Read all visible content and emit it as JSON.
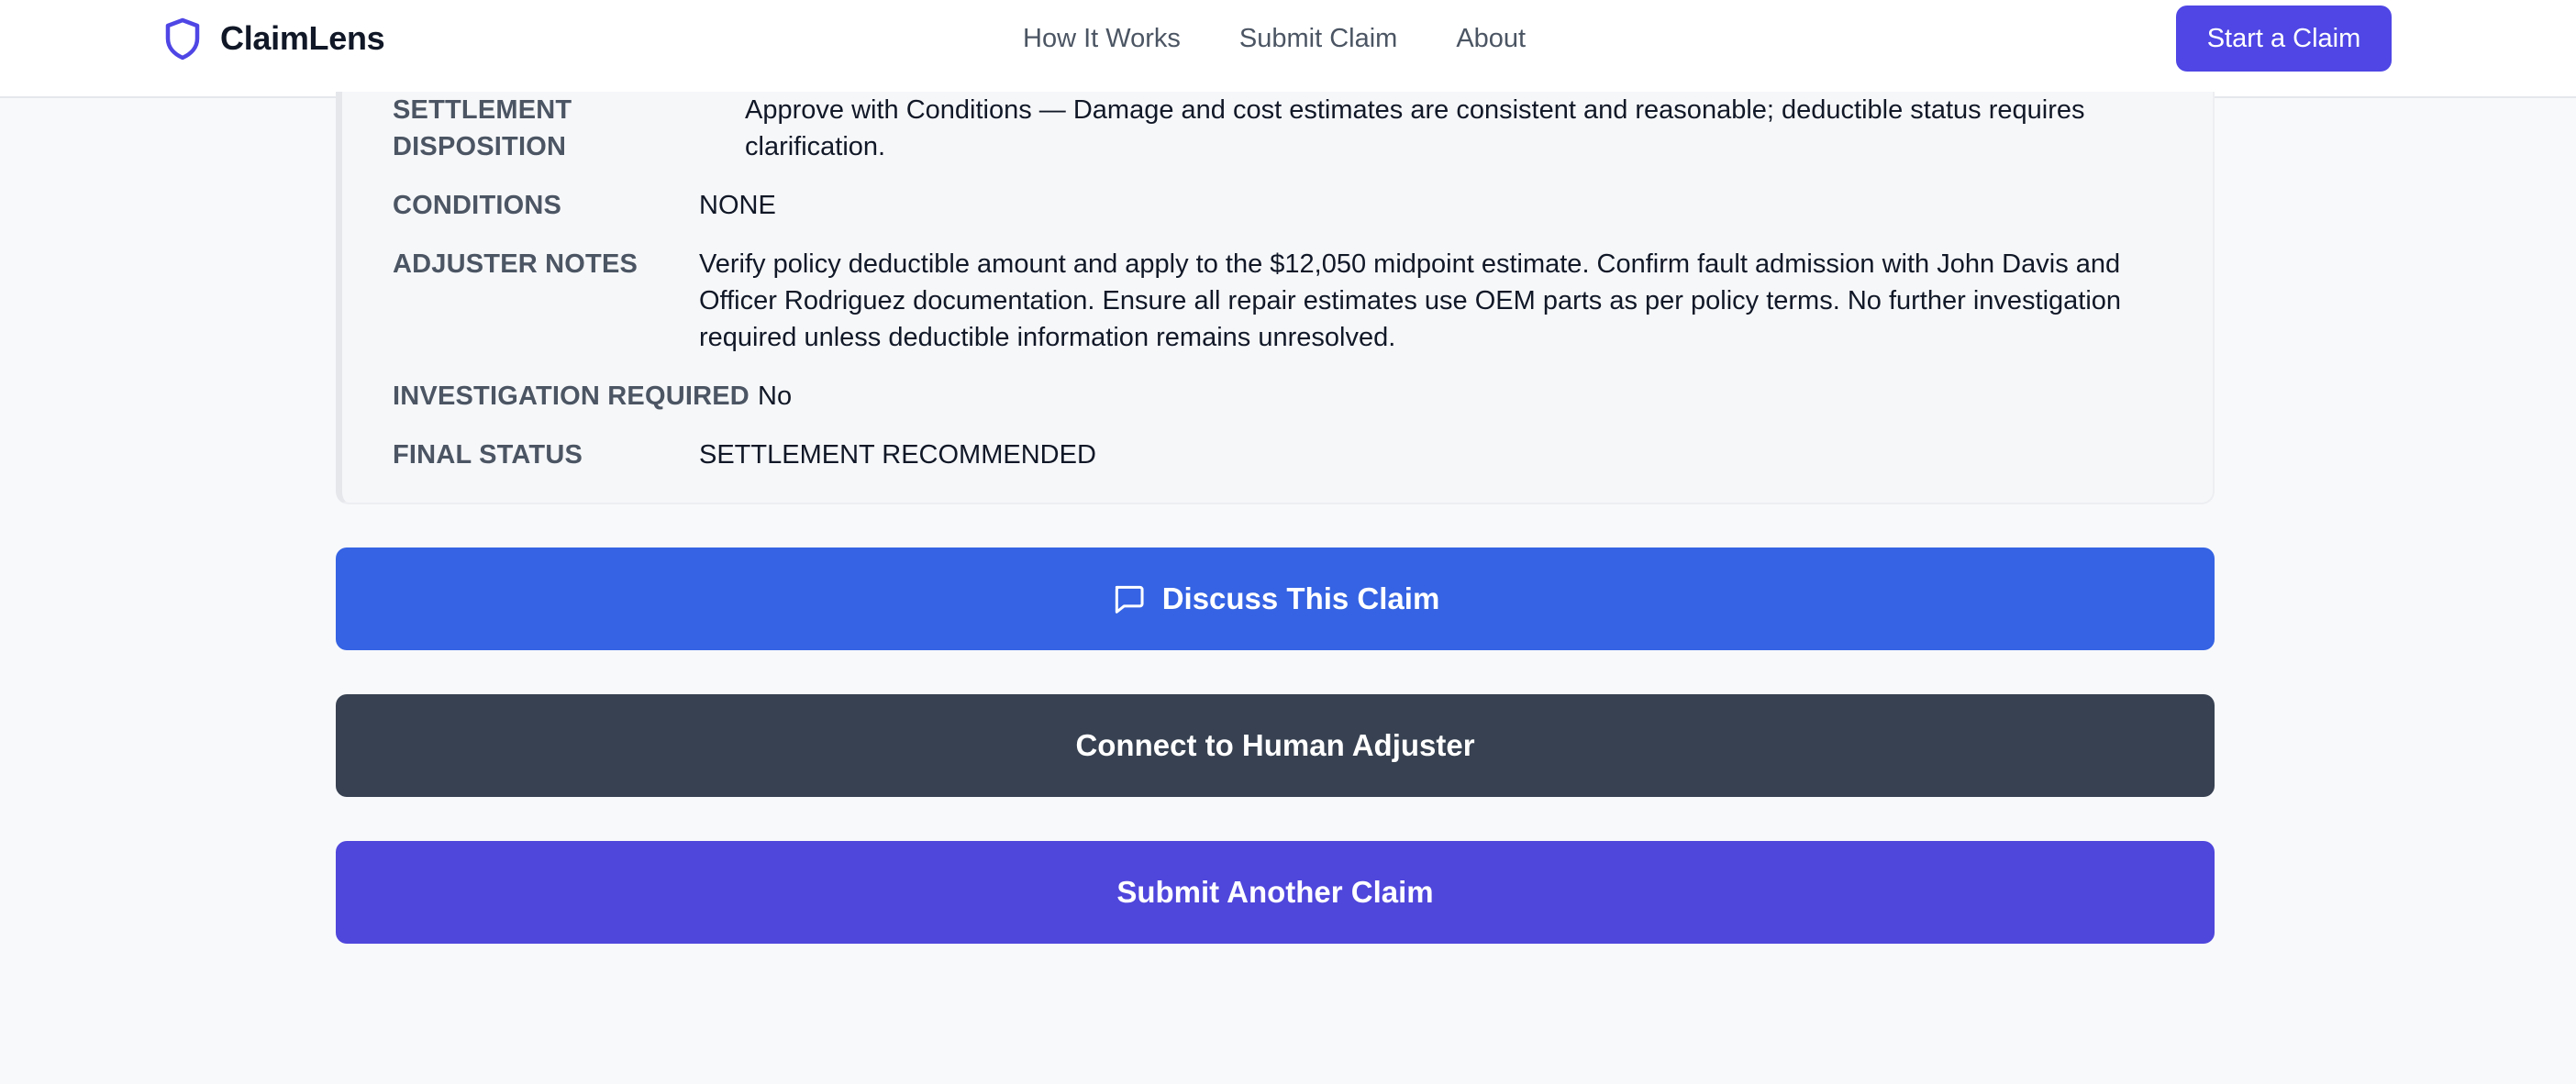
{
  "header": {
    "brand_name": "ClaimLens",
    "brand_icon": "shield-icon",
    "nav": [
      "How It Works",
      "Submit Claim",
      "About"
    ],
    "cta_label": "Start a Claim"
  },
  "result": {
    "settlement_disposition": {
      "label_line1": "SETTLEMENT",
      "label_line2": "DISPOSITION",
      "value_line1": "Approve with Conditions — Damage and cost estimates are consistent and reasonable; deductible status requires",
      "value_line2": "clarification."
    },
    "conditions": {
      "label": "CONDITIONS",
      "value": "NONE"
    },
    "adjuster_notes": {
      "label": "ADJUSTER NOTES",
      "value_line1": "Verify policy deductible amount and apply to the $12,050 midpoint estimate. Confirm fault admission with John Davis and",
      "value_line2": "Officer Rodriguez documentation. Ensure all repair estimates use OEM parts as per policy terms. No further investigation",
      "value_line3": "required unless deductible information remains unresolved."
    },
    "investigation_required": {
      "label": "INVESTIGATION REQUIRED",
      "value": "No"
    },
    "final_status": {
      "label": "FINAL STATUS",
      "value": "SETTLEMENT RECOMMENDED"
    }
  },
  "actions": {
    "discuss_label": "Discuss This Claim",
    "discuss_icon": "chat-bubble-icon",
    "human_label": "Connect to Human Adjuster",
    "another_label": "Submit Another Claim"
  },
  "colors": {
    "brand": "#4f46e5",
    "discuss": "#3563e3",
    "human": "#374151",
    "another": "#4f46dc",
    "page_bg": "#f8f9fb"
  }
}
